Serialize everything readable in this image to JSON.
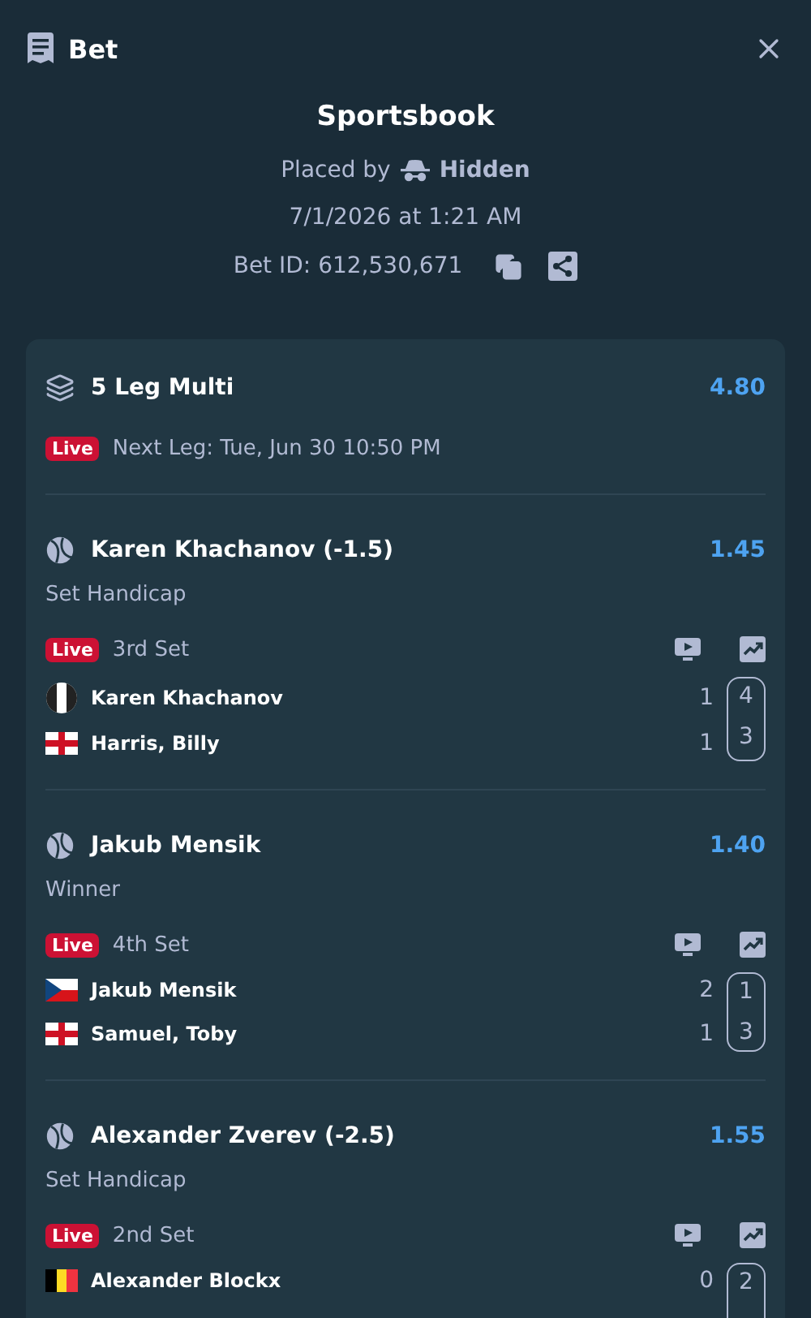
{
  "header": {
    "title": "Bet"
  },
  "summary": {
    "source": "Sportsbook",
    "placed_by_label": "Placed by",
    "placed_by_user": "Hidden",
    "date": "7/1/2026 at 1:21 AM",
    "bet_id": "Bet ID: 612,530,671"
  },
  "multi": {
    "title": "5 Leg Multi",
    "odds": "4.80",
    "live": true,
    "live_label": "Live",
    "next_leg": "Next Leg: Tue, Jun 30 10:50 PM"
  },
  "legs": [
    {
      "selection": "Karen Khachanov (-1.5)",
      "odds": "1.45",
      "market": "Set Handicap",
      "live": true,
      "live_label": "Live",
      "period": "3rd Set",
      "players": [
        {
          "name": "Karen Khachanov",
          "kind": "neutral",
          "sets": "1",
          "games": "4"
        },
        {
          "name": "Harris, Billy",
          "kind": "england",
          "sets": "1",
          "games": "3"
        }
      ]
    },
    {
      "selection": "Jakub Mensik",
      "odds": "1.40",
      "market": "Winner",
      "live": true,
      "live_label": "Live",
      "period": "4th Set",
      "players": [
        {
          "name": "Jakub Mensik",
          "kind": "czech",
          "sets": "2",
          "games": "1"
        },
        {
          "name": "Samuel, Toby",
          "kind": "england",
          "sets": "1",
          "games": "3"
        }
      ]
    },
    {
      "selection": "Alexander Zverev (-2.5)",
      "odds": "1.55",
      "market": "Set Handicap",
      "live": true,
      "live_label": "Live",
      "period": "2nd Set",
      "players": [
        {
          "name": "Alexander Blockx",
          "kind": "belgium",
          "sets": "0",
          "games": "2"
        }
      ]
    }
  ]
}
